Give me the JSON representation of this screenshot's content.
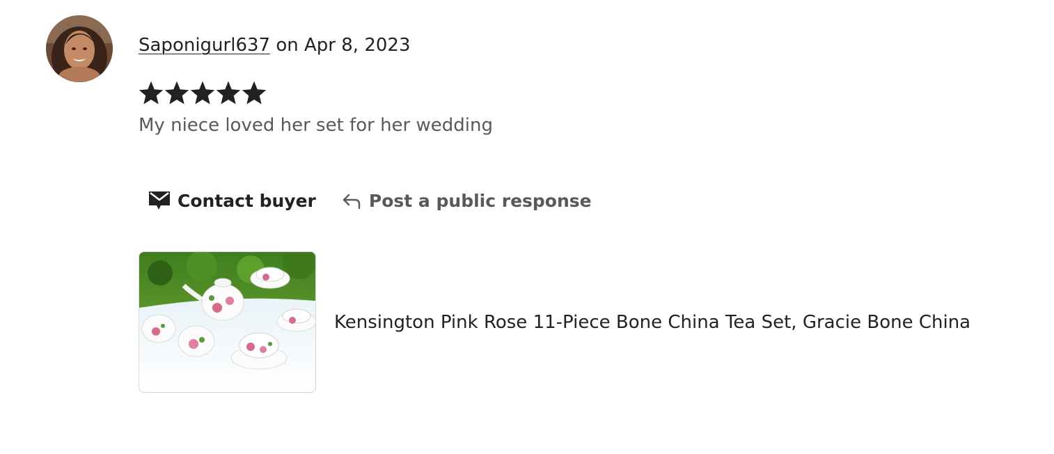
{
  "review": {
    "reviewer_name": "Saponigurl637",
    "date_prefix": " on ",
    "date": "Apr 8, 2023",
    "rating": 5,
    "rating_max": 5,
    "text": "My niece loved her set for her wedding"
  },
  "actions": {
    "contact_label": "Contact buyer",
    "contact_icon": "envelope-icon",
    "respond_label": "Post a public response",
    "respond_icon": "reply-arrow-icon"
  },
  "listing": {
    "title": "Kensington Pink Rose 11-Piece Bone China Tea Set, Gracie Bone China"
  },
  "colors": {
    "text_primary": "#222222",
    "text_secondary": "#595959",
    "star": "#222222",
    "thumb_border": "#d8d8d8"
  }
}
